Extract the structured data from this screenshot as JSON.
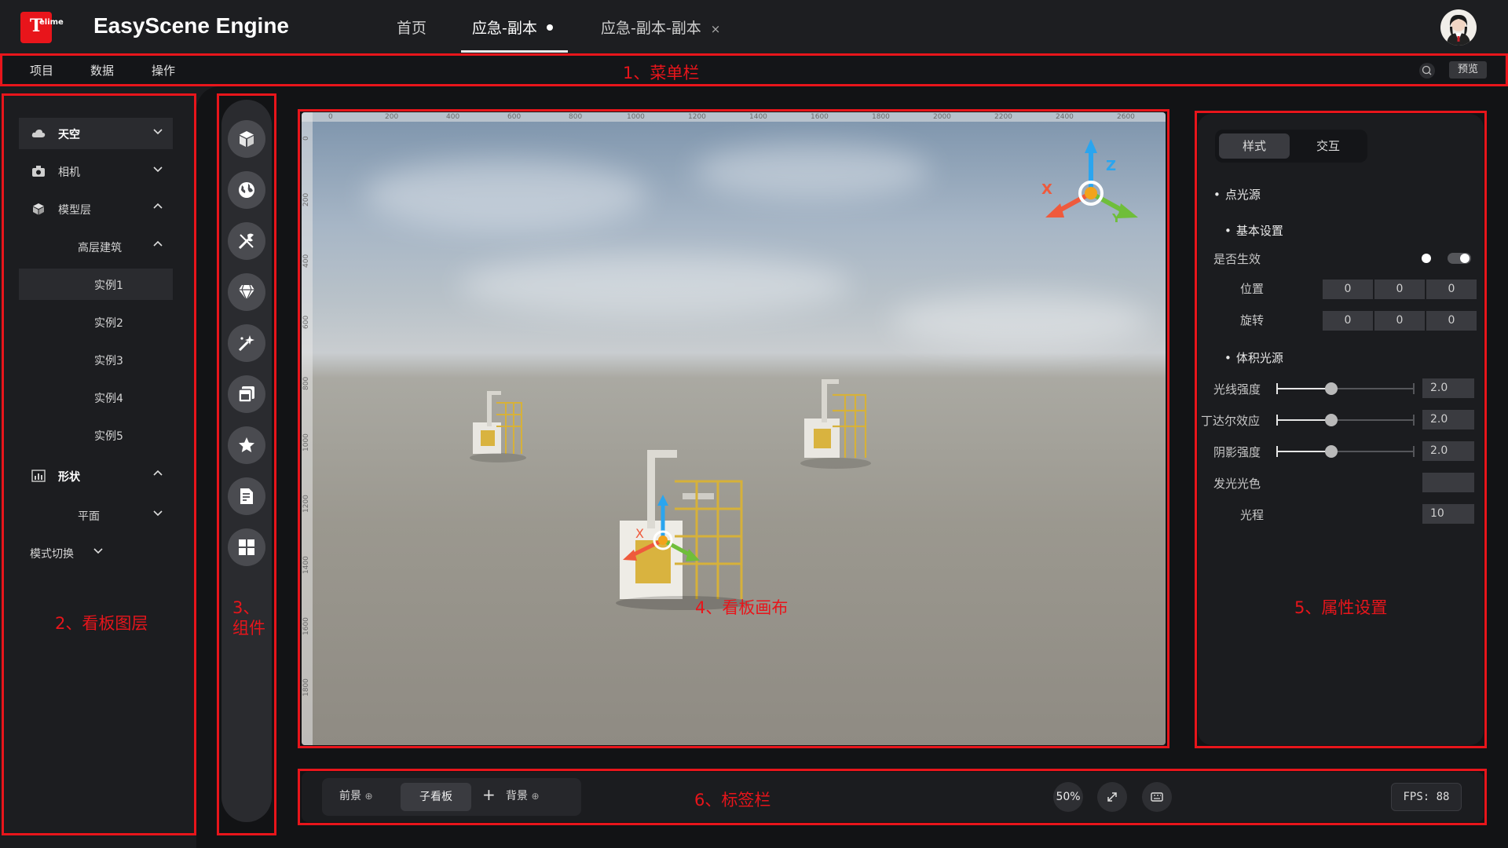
{
  "app": {
    "logo_letter": "T",
    "logo_sub": "elime",
    "title": "EasyScene Engine"
  },
  "tabs": [
    {
      "label": "首页"
    },
    {
      "label": "应急-副本"
    },
    {
      "label": "应急-副本-副本",
      "close": "×"
    }
  ],
  "menubar": {
    "items": [
      "项目",
      "数据",
      "操作"
    ],
    "preview_label": "预览"
  },
  "annotations": {
    "menubar": "1、菜单栏",
    "layers": "2、看板图层",
    "components_line1": "3、",
    "components_line2": "组件",
    "canvas": "4、看板画布",
    "props": "5、属性设置",
    "tagbar": "6、标签栏"
  },
  "layers": {
    "items": [
      {
        "label": "天空",
        "icon": "cloud-icon",
        "chevron": "down"
      },
      {
        "label": "相机",
        "icon": "camera-icon",
        "chevron": "down"
      },
      {
        "label": "模型层",
        "icon": "cube-icon",
        "chevron": "up"
      },
      {
        "label": "高层建筑",
        "chevron": "up"
      },
      {
        "label": "实例1",
        "selected": true
      },
      {
        "label": "实例2"
      },
      {
        "label": "实例3"
      },
      {
        "label": "实例4"
      },
      {
        "label": "实例5"
      },
      {
        "label": "形状",
        "icon": "chart-icon",
        "chevron": "up"
      },
      {
        "label": "平面",
        "chevron": "down"
      },
      {
        "label": "模式切换",
        "chevron": "down"
      }
    ]
  },
  "components": [
    "cube-icon",
    "globe-icon",
    "tools-icon",
    "gem-icon",
    "magic-icon",
    "window-icon",
    "star-icon",
    "document-icon",
    "grid-icon"
  ],
  "canvas": {
    "ruler_x": [
      "0",
      "200",
      "400",
      "600",
      "800",
      "1000",
      "1200",
      "1400",
      "1600",
      "1800",
      "2000",
      "2200",
      "2400",
      "2600"
    ],
    "ruler_y": [
      "0",
      "200",
      "400",
      "600",
      "800",
      "1000",
      "1200",
      "1400",
      "1600",
      "1800"
    ],
    "gizmo": {
      "x": "X",
      "y": "Y",
      "z": "Z"
    }
  },
  "props": {
    "tab_style": "样式",
    "tab_interact": "交互",
    "section_point_light": "点光源",
    "section_basic": "基本设置",
    "enabled_label": "是否生效",
    "position_label": "位置",
    "position": [
      "0",
      "0",
      "0"
    ],
    "rotation_label": "旋转",
    "rotation": [
      "0",
      "0",
      "0"
    ],
    "section_volume": "体积光源",
    "light_intensity_label": "光线强度",
    "light_intensity": "2.0",
    "light_intensity_level": 0.4,
    "tyndall_label": "丁达尔效应",
    "tyndall": "2.0",
    "tyndall_level": 0.4,
    "shadow_label": "阴影强度",
    "shadow": "2.0",
    "shadow_level": 0.4,
    "glow_color_label": "发光光色",
    "range_label": "光程",
    "range": "10"
  },
  "tagbar": {
    "foreground": "前景",
    "sub_board": "子看板",
    "add": "+",
    "background": "背景",
    "zoom": "50%",
    "fps": "FPS: 88"
  },
  "colors": {
    "accent_red": "#e8151b",
    "panel": "#1c1d20",
    "canvas_bg": "#121315"
  }
}
